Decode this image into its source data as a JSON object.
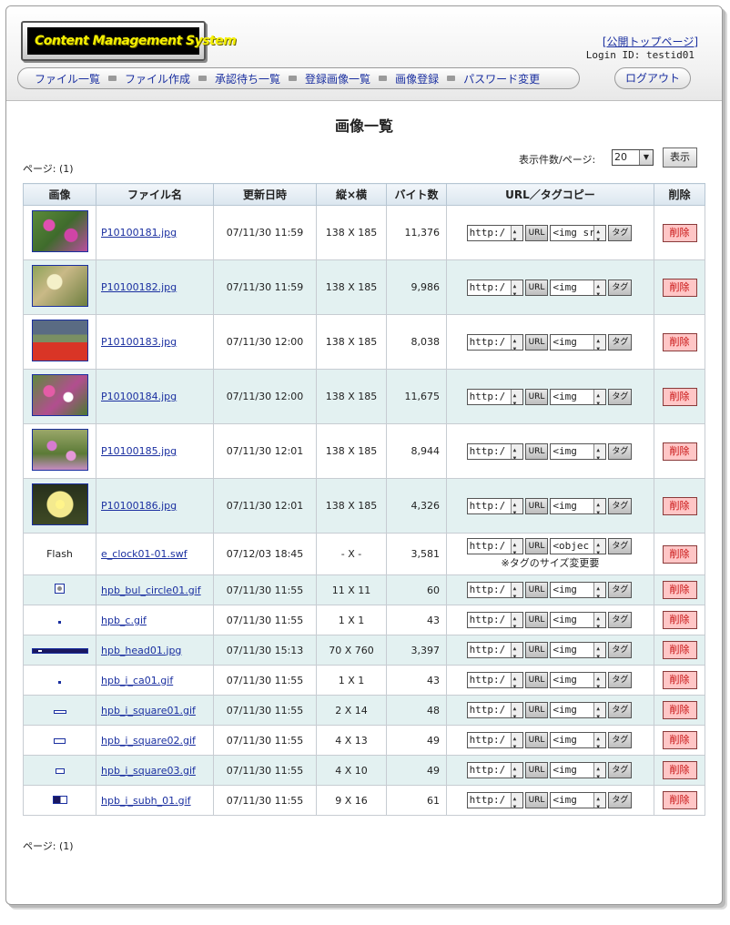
{
  "header": {
    "logo_text": "Content Management System",
    "public_link": "[公開トップページ]",
    "login_id": "Login ID: testid01",
    "logout_label": "ログアウト"
  },
  "nav": {
    "items": [
      {
        "label": "ファイル一覧"
      },
      {
        "label": "ファイル作成"
      },
      {
        "label": "承認待ち一覧"
      },
      {
        "label": "登録画像一覧"
      },
      {
        "label": "画像登録"
      },
      {
        "label": "パスワード変更"
      }
    ]
  },
  "page": {
    "title": "画像一覧",
    "page_indicator_top": "ページ: (1)",
    "page_indicator_bottom": "ページ: (1)",
    "per_page_label": "表示件数/ページ:",
    "per_page_value": "20",
    "display_button": "表示"
  },
  "table": {
    "headers": {
      "image": "画像",
      "filename": "ファイル名",
      "updated": "更新日時",
      "dimensions": "縦×横",
      "bytes": "バイト数",
      "copy": "URL／タグコピー",
      "delete": "削除"
    },
    "url_button": "URL",
    "tag_button": "タグ",
    "delete_button": "削除",
    "rows": [
      {
        "thumb": "photo-1",
        "filename": "P10100181.jpg",
        "updated": "07/11/30 11:59",
        "dimensions": "138 X 185",
        "bytes": "11,376",
        "url_value": "http:/",
        "tag_value": "<img src=\"h"
      },
      {
        "thumb": "photo-2",
        "filename": "P10100182.jpg",
        "updated": "07/11/30 11:59",
        "dimensions": "138 X 185",
        "bytes": "9,986",
        "url_value": "http:/",
        "tag_value": "<img"
      },
      {
        "thumb": "photo-3",
        "filename": "P10100183.jpg",
        "updated": "07/11/30 12:00",
        "dimensions": "138 X 185",
        "bytes": "8,038",
        "url_value": "http:/",
        "tag_value": "<img"
      },
      {
        "thumb": "photo-4",
        "filename": "P10100184.jpg",
        "updated": "07/11/30 12:00",
        "dimensions": "138 X 185",
        "bytes": "11,675",
        "url_value": "http:/",
        "tag_value": "<img"
      },
      {
        "thumb": "photo-5",
        "filename": "P10100185.jpg",
        "updated": "07/11/30 12:01",
        "dimensions": "138 X 185",
        "bytes": "8,944",
        "url_value": "http:/",
        "tag_value": "<img"
      },
      {
        "thumb": "photo-6",
        "filename": "P10100186.jpg",
        "updated": "07/11/30 12:01",
        "dimensions": "138 X 185",
        "bytes": "4,326",
        "url_value": "http:/",
        "tag_value": "<img"
      },
      {
        "thumb": "flash",
        "thumb_label": "Flash",
        "filename": "e_clock01-01.swf",
        "updated": "07/12/03 18:45",
        "dimensions": "- X -",
        "bytes": "3,581",
        "url_value": "http:/",
        "tag_value": "<objec",
        "note": "※タグのサイズ変更要"
      },
      {
        "thumb": "circle-icon",
        "filename": "hpb_bul_circle01.gif",
        "updated": "07/11/30 11:55",
        "dimensions": "11 X 11",
        "bytes": "60",
        "url_value": "http:/",
        "tag_value": "<img"
      },
      {
        "thumb": "dot-icon",
        "filename": "hpb_c.gif",
        "updated": "07/11/30 11:55",
        "dimensions": "1 X 1",
        "bytes": "43",
        "url_value": "http:/",
        "tag_value": "<img"
      },
      {
        "thumb": "header-bar",
        "filename": "hpb_head01.jpg",
        "updated": "07/11/30 15:13",
        "dimensions": "70 X 760",
        "bytes": "3,397",
        "url_value": "http:/",
        "tag_value": "<img"
      },
      {
        "thumb": "dot-icon",
        "filename": "hpb_i_ca01.gif",
        "updated": "07/11/30 11:55",
        "dimensions": "1 X 1",
        "bytes": "43",
        "url_value": "http:/",
        "tag_value": "<img"
      },
      {
        "thumb": "square-1",
        "filename": "hpb_i_square01.gif",
        "updated": "07/11/30 11:55",
        "dimensions": "2 X 14",
        "bytes": "48",
        "url_value": "http:/",
        "tag_value": "<img"
      },
      {
        "thumb": "square-2",
        "filename": "hpb_i_square02.gif",
        "updated": "07/11/30 11:55",
        "dimensions": "4 X 13",
        "bytes": "49",
        "url_value": "http:/",
        "tag_value": "<img"
      },
      {
        "thumb": "square-3",
        "filename": "hpb_i_square03.gif",
        "updated": "07/11/30 11:55",
        "dimensions": "4 X 10",
        "bytes": "49",
        "url_value": "http:/",
        "tag_value": "<img"
      },
      {
        "thumb": "subhead",
        "filename": "hpb_i_subh_01.gif",
        "updated": "07/11/30 11:55",
        "dimensions": "9 X 16",
        "bytes": "61",
        "url_value": "http:/",
        "tag_value": "<img"
      }
    ]
  }
}
